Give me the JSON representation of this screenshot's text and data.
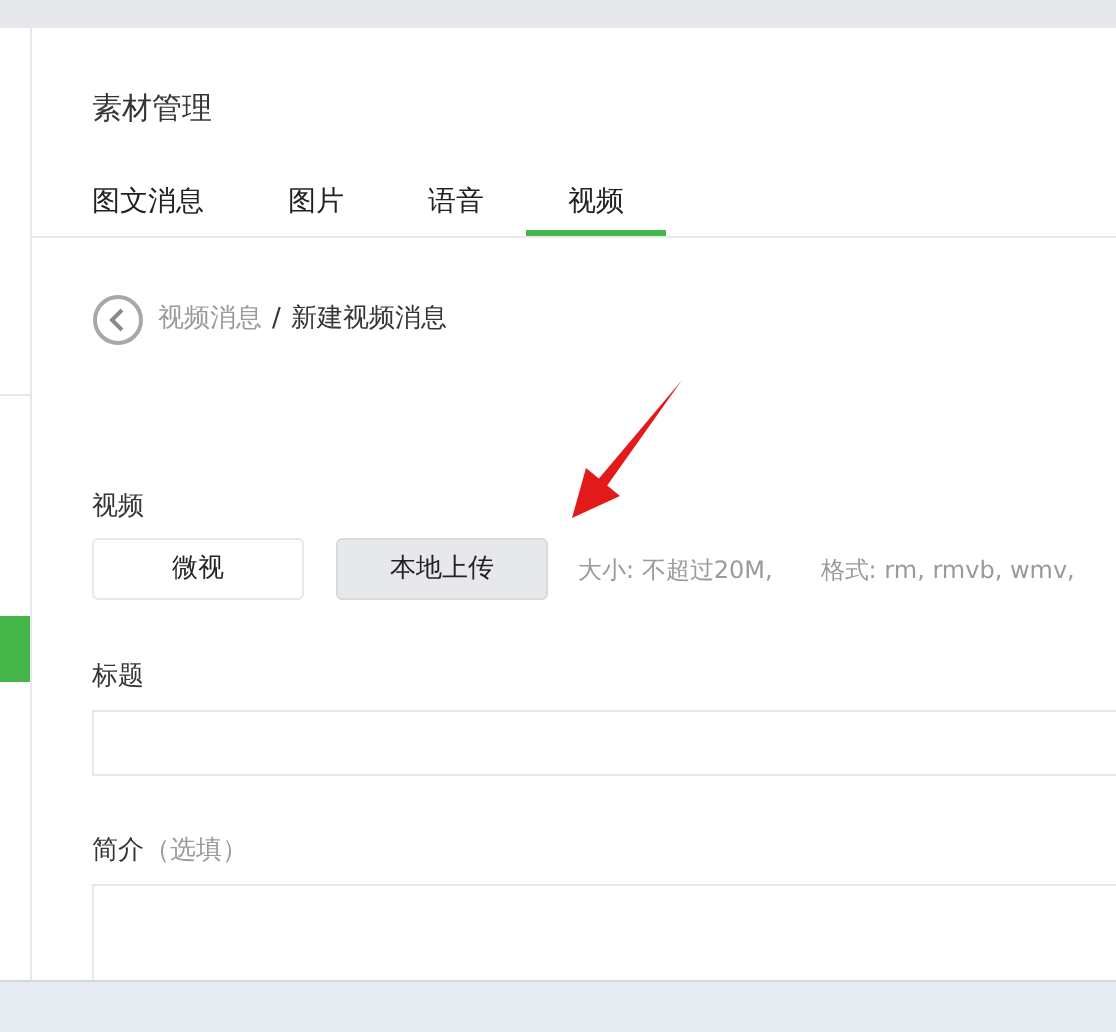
{
  "page_title": "素材管理",
  "tabs": [
    {
      "label": "图文消息",
      "selected": false
    },
    {
      "label": "图片",
      "selected": false
    },
    {
      "label": "语音",
      "selected": false
    },
    {
      "label": "视频",
      "selected": true
    }
  ],
  "breadcrumb": {
    "parent": "视频消息",
    "separator": "/",
    "current": "新建视频消息"
  },
  "video": {
    "label": "视频",
    "sources": [
      {
        "label": "微视",
        "selected": false
      },
      {
        "label": "本地上传",
        "selected": true
      }
    ],
    "hints": [
      "大小: 不超过20M,",
      "格式: rm, rmvb, wmv,"
    ]
  },
  "title_field": {
    "label": "标题"
  },
  "summary_field": {
    "label": "简介",
    "note": "（选填）"
  }
}
